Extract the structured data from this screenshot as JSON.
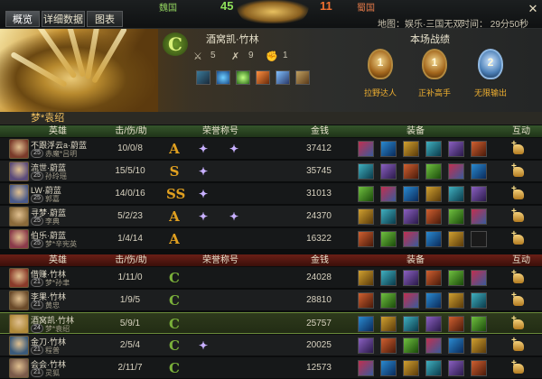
{
  "tabs": [
    "概览",
    "详细数据",
    "图表"
  ],
  "scoreboard": {
    "left_team": "魏国",
    "left_score": "45",
    "right_score": "11",
    "right_team": "蜀国",
    "map": "地图：娱乐·三国无双",
    "time": "时间： 29分50秒"
  },
  "hero_panel": {
    "hero_name": "酒窝凯·竹林",
    "kills": "5",
    "deaths": "9",
    "assists": "1",
    "stats_title": "本场战绩",
    "badges": [
      {
        "num": "1",
        "label": "拉野达人",
        "style": "gold"
      },
      {
        "num": "1",
        "label": "正补高手",
        "style": "gold"
      },
      {
        "num": "2",
        "label": "无限输出",
        "style": "blue"
      }
    ],
    "player_name": "梦*袁绍"
  },
  "headers": {
    "hero": "英雄",
    "kda": "击/伤/助",
    "honor": "荣誉称号",
    "gold": "金钱",
    "equip": "装备",
    "interact": "互动"
  },
  "team_green": [
    {
      "name": "不跟浮云a·蔚蓝",
      "level": "25",
      "guild": "赤魔*吕明",
      "kda": "10/0/8",
      "gold": "37412",
      "honors": [
        "A",
        "✦",
        "✦"
      ],
      "avatar": "#7a3a2a"
    },
    {
      "name": "流世·蔚蓝",
      "level": "25",
      "guild": "孙玲瑶",
      "kda": "15/5/10",
      "gold": "35745",
      "honors": [
        "S",
        "✦"
      ],
      "avatar": "#5a4a7a"
    },
    {
      "name": "LW·蔚蓝",
      "level": "25",
      "guild": "郭嘉",
      "kda": "14/0/16",
      "gold": "31013",
      "honors": [
        "SS",
        "✦"
      ],
      "avatar": "#4a5a8a"
    },
    {
      "name": "寻梦·蔚蓝",
      "level": "25",
      "guild": "李典",
      "kda": "5/2/23",
      "gold": "24370",
      "honors": [
        "A",
        "✦",
        "✦"
      ],
      "avatar": "#8a6a3a"
    },
    {
      "name": "伯乐·蔚蓝",
      "level": "25",
      "guild": "梦*辛宪英",
      "kda": "1/4/14",
      "gold": "16322",
      "honors": [
        "A"
      ],
      "avatar": "#8a3a4a"
    }
  ],
  "team_red": [
    {
      "name": "借赚·竹林",
      "level": "21",
      "guild": "梦*孙聿",
      "kda": "1/11/0",
      "gold": "24028",
      "honors": [
        "C"
      ],
      "avatar": "#8a3a2a"
    },
    {
      "name": "李果·竹林",
      "level": "21",
      "guild": "黄忠",
      "kda": "1/9/5",
      "gold": "28810",
      "honors": [
        "C"
      ],
      "avatar": "#6a4a2a"
    },
    {
      "name": "酒窝凯·竹林",
      "level": "24",
      "guild": "梦*袁绍",
      "kda": "5/9/1",
      "gold": "25757",
      "honors": [
        "C"
      ],
      "avatar": "#b08a3a"
    },
    {
      "name": "金刀·竹林",
      "level": "21",
      "guild": "程普",
      "kda": "2/5/4",
      "gold": "20025",
      "honors": [
        "C",
        "✦"
      ],
      "avatar": "#3a5a7a"
    },
    {
      "name": "会会·竹林",
      "level": "21",
      "guild": "灵狐",
      "kda": "2/11/7",
      "gold": "12573",
      "honors": [
        "C"
      ],
      "avatar": "#7a5a4a"
    }
  ],
  "colors": {
    "green_team": "#35552b",
    "red_team": "#6a1f16",
    "honor_gold": "#e0a020",
    "honor_c": "#7ab03a",
    "highlight": "#6a8a3a"
  }
}
